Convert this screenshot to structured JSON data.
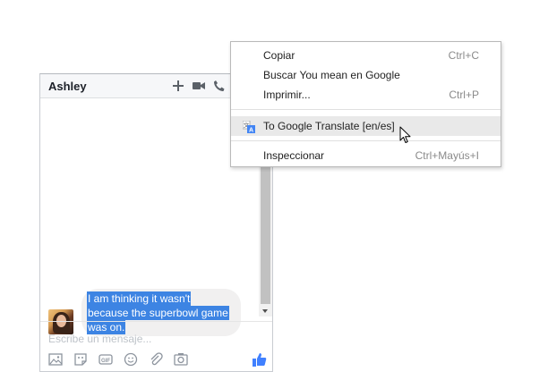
{
  "chat": {
    "title": "Ashley",
    "header_icons": [
      "plus-icon",
      "video-camera-icon",
      "phone-icon"
    ],
    "message_lines": [
      "I am thinking it wasn't",
      "because the superbowl game",
      "was on."
    ],
    "composer_placeholder": "Escribe un mensaje...",
    "composer_icons": [
      "photo-icon",
      "sticker-icon",
      "gif-icon",
      "emoji-icon",
      "attachment-icon",
      "camera-icon"
    ],
    "like_icon": "thumbs-up-icon"
  },
  "context_menu": {
    "items": [
      {
        "label": "Copiar",
        "shortcut": "Ctrl+C"
      },
      {
        "label": "Buscar You mean en Google",
        "shortcut": ""
      },
      {
        "label": "Imprimir...",
        "shortcut": "Ctrl+P"
      },
      {
        "label": "To Google Translate [en/es]",
        "shortcut": "",
        "icon": "google-translate-icon",
        "highlighted": true
      },
      {
        "label": "Inspeccionar",
        "shortcut": "Ctrl+Mayús+I"
      }
    ]
  },
  "colors": {
    "selection": "#3d84e3",
    "like": "#4080ff",
    "menu_highlight": "#e9e9e9"
  }
}
